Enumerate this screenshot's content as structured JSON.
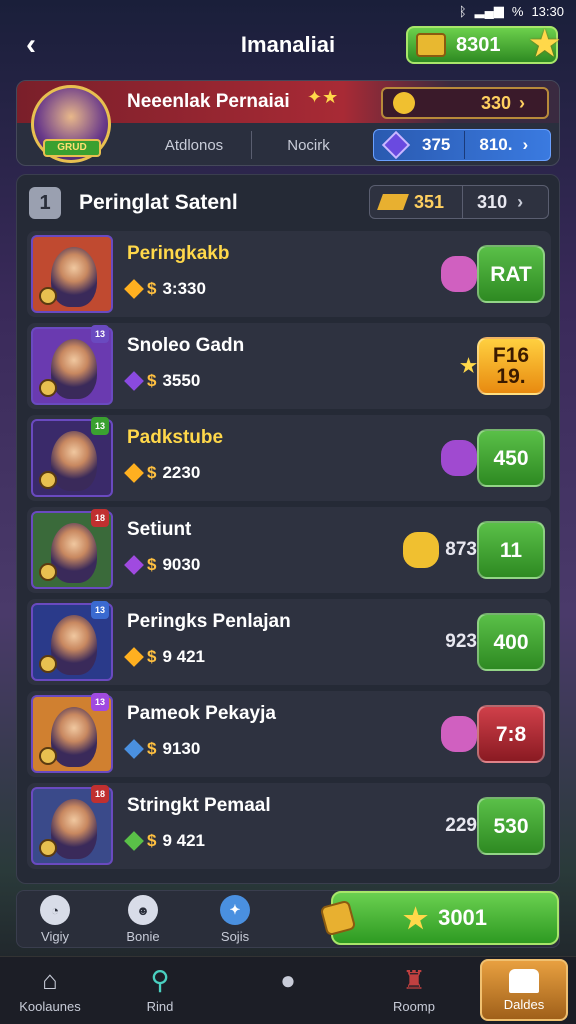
{
  "status": {
    "icons": [
      "bluetooth-icon",
      "signal-icon",
      "wifi-icon"
    ],
    "battery": "%",
    "time": "13:30"
  },
  "header": {
    "title": "Imanaliai",
    "back_symbol": "‹",
    "currency_value": "8301"
  },
  "profile": {
    "avatar_tag": "GRUD",
    "name": "Neeenlak Pernaiai",
    "coins": "330",
    "tabs": [
      "Atdlonos",
      "Nocirk"
    ],
    "gems_1": "375",
    "gems_2": "810.",
    "arrow": "›"
  },
  "list": {
    "rank_symbol": "1",
    "title": "Peringlat Satenl",
    "gold": "351",
    "value_2": "310",
    "arrow": "›",
    "rows": [
      {
        "name": "Peringkakb",
        "name_color": "#ffd84a",
        "badge": "",
        "badge_color": "#6a4ac0",
        "stat_icon": "#ffb020",
        "stat_prefix": "$",
        "stat_value": "3:330",
        "item_text": "",
        "action": "RAT",
        "action_style": "act-green",
        "gem_color": "#d060c0",
        "portrait_bg": "#c04a30"
      },
      {
        "name": "Snoleo Gadn",
        "name_color": "#ffffff",
        "badge": "13",
        "badge_color": "#6a4ac0",
        "stat_icon": "#8a4ae0",
        "stat_prefix": "$",
        "stat_value": "3550",
        "item_text": "★",
        "action": "F16 19.",
        "action_style": "act-yellow",
        "gem_color": "",
        "portrait_bg": "#6a3ab0"
      },
      {
        "name": "Padkstube",
        "name_color": "#ffd84a",
        "badge": "13",
        "badge_color": "#3aa030",
        "stat_icon": "#ffb020",
        "stat_prefix": "$",
        "stat_value": "2230",
        "item_text": "",
        "action": "450",
        "action_style": "act-green",
        "gem_color": "#a04ad0",
        "portrait_bg": "#3a2a6a"
      },
      {
        "name": "Setiunt",
        "name_color": "#ffffff",
        "badge": "18",
        "badge_color": "#c03030",
        "stat_icon": "#a04ae0",
        "stat_prefix": "$",
        "stat_value": "9030",
        "item_text": "873",
        "action": "11",
        "action_style": "act-green",
        "gem_color": "#f0c030",
        "portrait_bg": "#3a6a3a"
      },
      {
        "name": "Peringks Penlajan",
        "name_color": "#ffffff",
        "badge": "13",
        "badge_color": "#3a6ad0",
        "stat_icon": "#ffb020",
        "stat_prefix": "$",
        "stat_value": "9 421",
        "item_text": "923",
        "action": "400",
        "action_style": "act-green",
        "gem_color": "",
        "portrait_bg": "#2a3a8a"
      },
      {
        "name": "Pameok Pekayja",
        "name_color": "#ffffff",
        "badge": "13",
        "badge_color": "#a04ae0",
        "stat_icon": "#4a90e0",
        "stat_prefix": "$",
        "stat_value": "9130",
        "item_text": "",
        "action": "7:8",
        "action_style": "act-red",
        "gem_color": "#d060c0",
        "portrait_bg": "#d08030"
      },
      {
        "name": "Stringkt Pemaal",
        "name_color": "#ffffff",
        "badge": "18",
        "badge_color": "#c03030",
        "stat_icon": "#5ac048",
        "stat_prefix": "$",
        "stat_value": "9 421",
        "item_text": "229",
        "action": "530",
        "action_style": "act-green",
        "gem_color": "",
        "portrait_bg": "#3a4a8a"
      }
    ]
  },
  "bottom": {
    "items": [
      {
        "label": "Vigiy",
        "icon": "chat-icon"
      },
      {
        "label": "Bonie",
        "icon": "skull-icon"
      },
      {
        "label": "Sojis",
        "icon": "crystal-icon"
      }
    ],
    "claim_value": "3001"
  },
  "nav": {
    "items": [
      {
        "label": "Koolaunes",
        "icon": "home-icon",
        "glyph": "⌂"
      },
      {
        "label": "Rind",
        "icon": "search-icon",
        "glyph": "⚲"
      },
      {
        "label": "",
        "icon": "ghost-icon",
        "glyph": "●"
      },
      {
        "label": "Roomp",
        "icon": "joystick-icon",
        "glyph": "♜"
      }
    ],
    "active_label": "Daldes"
  },
  "colors": {
    "accent_green": "#5ac048",
    "gold": "#ffd060",
    "panel": "#2e3240"
  }
}
